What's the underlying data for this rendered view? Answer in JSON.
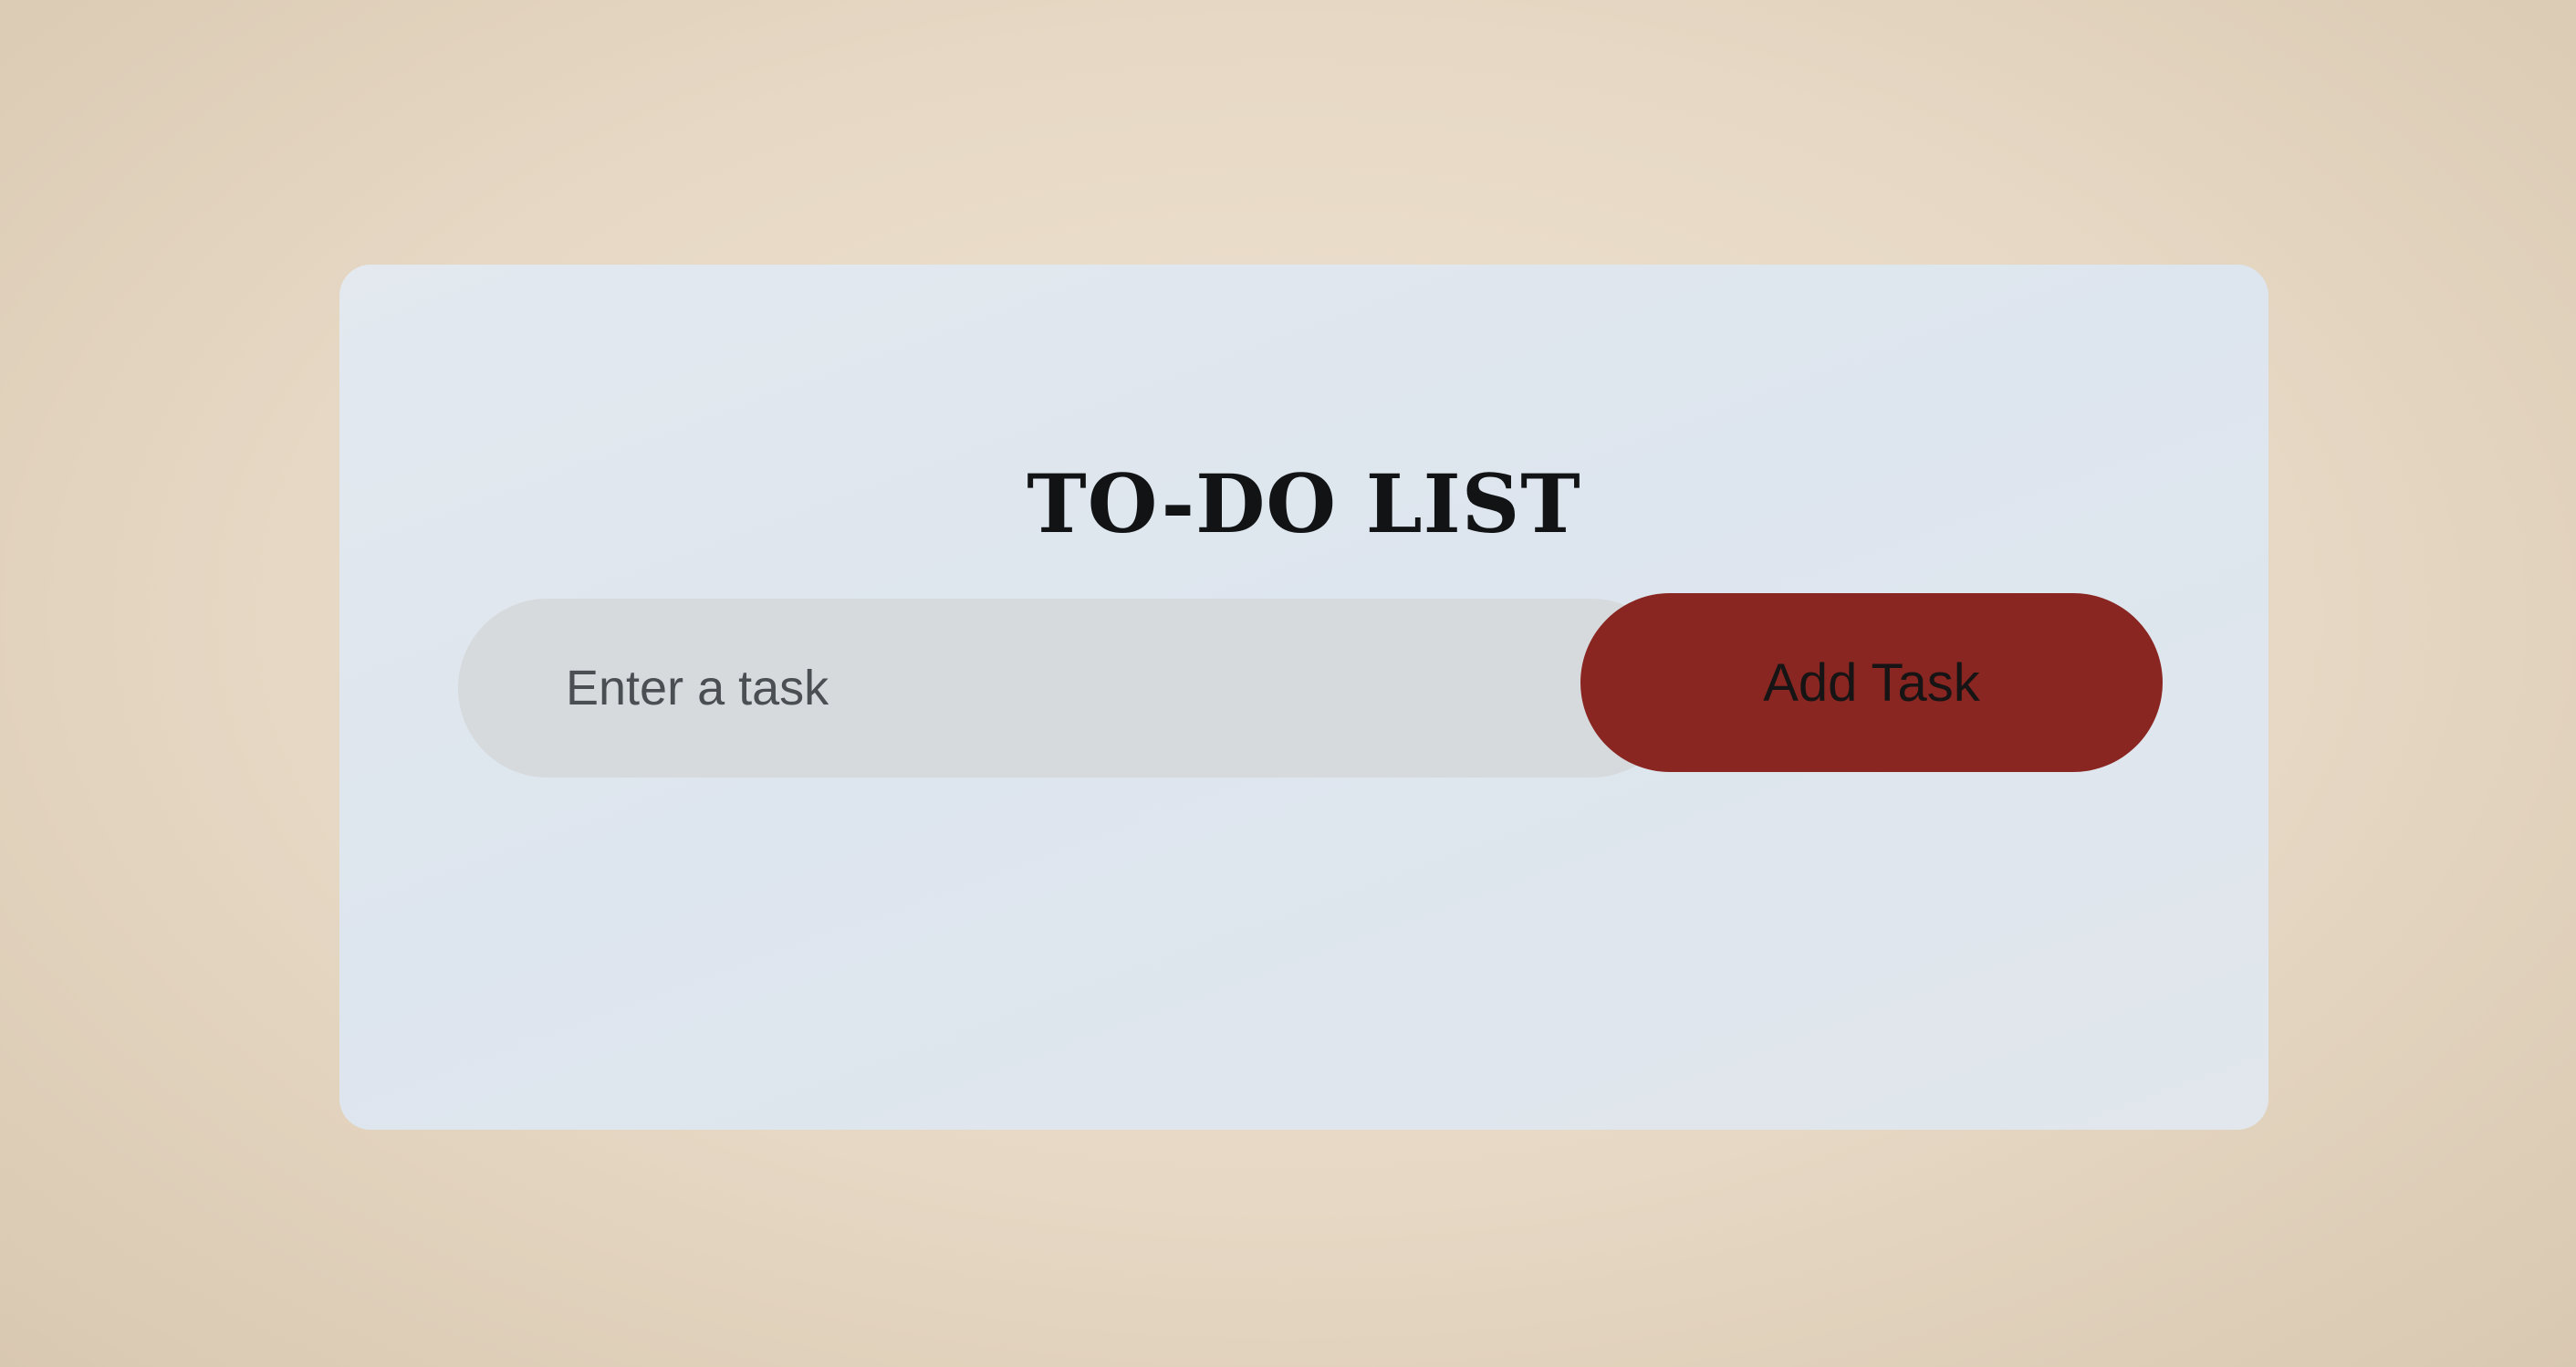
{
  "app": {
    "title": "TO-DO LIST"
  },
  "task_form": {
    "input_placeholder": "Enter a task",
    "input_value": "",
    "add_button_label": "Add Task"
  },
  "colors": {
    "background": "#e6d8c4",
    "card": "#e1e7ee",
    "input_background": "#d6dadd",
    "add_button": "#8a2621",
    "title_text": "#111315"
  },
  "tasks": []
}
